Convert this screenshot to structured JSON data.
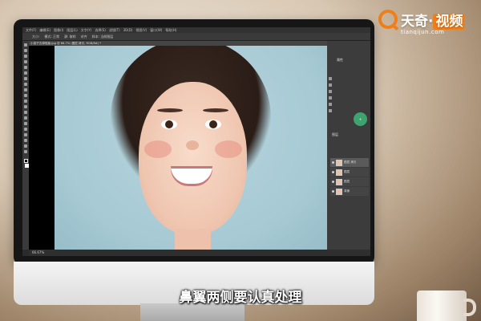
{
  "logo": {
    "brand": "天奇",
    "suffix": "视频",
    "url": "tianqijun.com"
  },
  "photoshop": {
    "menu": [
      "文件(F)",
      "编辑(E)",
      "图像(I)",
      "图层(L)",
      "文字(Y)",
      "选择(S)",
      "滤镜(T)",
      "3D(D)",
      "视图(V)",
      "窗口(W)",
      "帮助(H)"
    ],
    "options": [
      "大小:",
      "模式: 正常",
      "源: 取样",
      "对齐",
      "样本: 当前图层"
    ],
    "doc_tab": "小孩子去掉斑痕.jpg @ 66.7% (图层 拷贝, RGB/8#) *",
    "status": "66.67%",
    "properties_title": "属性",
    "layers_title": "图层",
    "badge_text": "+",
    "layers": [
      {
        "name": "图层 拷贝",
        "active": true
      },
      {
        "name": "图层",
        "active": false
      },
      {
        "name": "图层",
        "active": false
      },
      {
        "name": "背景",
        "active": false
      }
    ]
  },
  "subtitle": "鼻翼两侧要认真处理"
}
